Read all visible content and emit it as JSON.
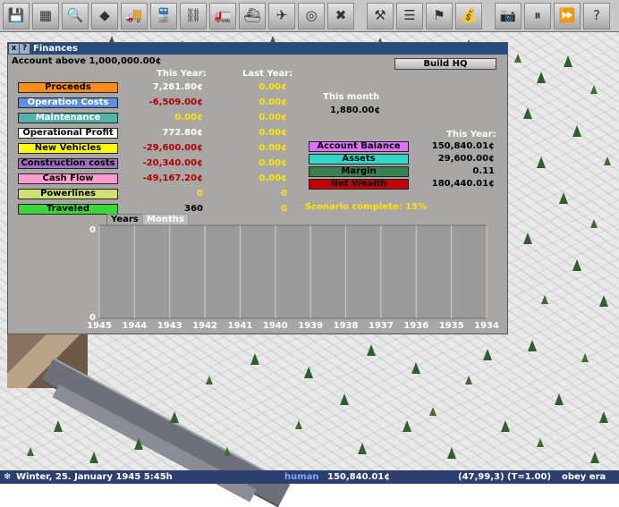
{
  "toolbar": {
    "buttons": [
      {
        "icon": "disk-icon",
        "glyph": "💾",
        "gap": false
      },
      {
        "icon": "minimap-icon",
        "glyph": "▦",
        "gap": false
      },
      {
        "icon": "magnifier-icon",
        "glyph": "🔍",
        "gap": false
      },
      {
        "icon": "terrain-icon",
        "glyph": "◆",
        "gap": false
      },
      {
        "icon": "road-vehicle-icon",
        "glyph": "🚚",
        "gap": false
      },
      {
        "icon": "train-icon",
        "glyph": "🚆",
        "gap": false
      },
      {
        "icon": "rail-tool-icon",
        "glyph": "⛓",
        "gap": false
      },
      {
        "icon": "truck-icon",
        "glyph": "🚛",
        "gap": false
      },
      {
        "icon": "ship-icon",
        "glyph": "⛴",
        "gap": false
      },
      {
        "icon": "airplane-icon",
        "glyph": "✈",
        "gap": false
      },
      {
        "icon": "target-icon",
        "glyph": "◎",
        "gap": false
      },
      {
        "icon": "remove-icon",
        "glyph": "✖",
        "gap": false
      },
      {
        "icon": "build-icon",
        "glyph": "⚒",
        "gap": true
      },
      {
        "icon": "list-icon",
        "glyph": "☰",
        "gap": false
      },
      {
        "icon": "sign-icon",
        "glyph": "⚑",
        "gap": false
      },
      {
        "icon": "money-icon",
        "glyph": "💰",
        "gap": false
      },
      {
        "icon": "camera-icon",
        "glyph": "📷",
        "gap": true
      },
      {
        "icon": "pause-icon",
        "glyph": "⏸",
        "gap": false
      },
      {
        "icon": "fast-forward-icon",
        "glyph": "⏩",
        "gap": false
      },
      {
        "icon": "help-icon",
        "glyph": "?",
        "gap": false
      }
    ]
  },
  "window": {
    "close_glyph": "x",
    "help_glyph": "?",
    "title": "Finances",
    "account_note": "Account above 1,000,000.00¢",
    "build_hq_label": "Build HQ",
    "this_year_header": "This Year:",
    "last_year_header": "Last Year:",
    "this_month_header": "This month",
    "this_month_value": "1,880.00¢",
    "this_year_header_2": "This Year:",
    "scenario_text": "Scenario complete: 15%",
    "rows": [
      {
        "label": "Proceeds",
        "bg": "#ff8c1a",
        "fg": "#000000",
        "this_year": "7,281.80¢",
        "ty_color": "#ffffff",
        "last_year": "0.00¢"
      },
      {
        "label": "Operation Costs",
        "bg": "#5b8fe0",
        "fg": "#ffffff",
        "this_year": "-6,509.00¢",
        "ty_color": "#b10000",
        "last_year": "0.00¢"
      },
      {
        "label": "Maintenance",
        "bg": "#53b3aa",
        "fg": "#ffffff",
        "this_year": "0.00¢",
        "ty_color": "#ffe300",
        "last_year": "0.00¢"
      },
      {
        "label": "Operational Profit",
        "bg": "#ffffff",
        "fg": "#000000",
        "this_year": "772.80¢",
        "ty_color": "#ffffff",
        "last_year": "0.00¢"
      },
      {
        "label": "New Vehicles",
        "bg": "#ffff00",
        "fg": "#000000",
        "this_year": "-29,600.00¢",
        "ty_color": "#b10000",
        "last_year": "0.00¢"
      },
      {
        "label": "Construction costs",
        "bg": "#a070c0",
        "fg": "#000000",
        "this_year": "-20,340.00¢",
        "ty_color": "#b10000",
        "last_year": "0.00¢"
      },
      {
        "label": "Cash Flow",
        "bg": "#ff9cd0",
        "fg": "#000000",
        "this_year": "-49,167.20¢",
        "ty_color": "#b10000",
        "last_year": "0.00¢"
      },
      {
        "label": "Powerlines",
        "bg": "#cfe070",
        "fg": "#000000",
        "this_year": "0",
        "ty_color": "#ffe300",
        "last_year": "0"
      },
      {
        "label": "Traveled",
        "bg": "#38d838",
        "fg": "#000000",
        "this_year": "360",
        "ty_color": "#000000",
        "last_year": "0"
      }
    ],
    "summary": [
      {
        "label": "Account Balance",
        "bg": "#e070ff",
        "fg": "#000000",
        "value": "150,840.01¢"
      },
      {
        "label": "Assets",
        "bg": "#30d8c8",
        "fg": "#000000",
        "value": "29,600.00¢"
      },
      {
        "label": "Margin",
        "bg": "#3a8050",
        "fg": "#000000",
        "value": "0.11"
      },
      {
        "label": "Net Wealth",
        "bg": "#c00000",
        "fg": "#000000",
        "value": "180,440.01¢"
      }
    ],
    "chart_tabs": {
      "years": "Years",
      "months": "Months"
    }
  },
  "chart_data": {
    "type": "line",
    "title": "",
    "xlabel": "",
    "ylabel": "",
    "categories": [
      "1945",
      "1944",
      "1943",
      "1942",
      "1941",
      "1940",
      "1939",
      "1938",
      "1937",
      "1936",
      "1935",
      "1934"
    ],
    "y_ticks": [
      "0",
      "0"
    ],
    "series": [],
    "grid": true
  },
  "status": {
    "date": "Winter, 25. January 1945 5:45h",
    "player": "human",
    "balance": "150,840.01¢",
    "coords": "(47,99,3) (T=1.00)",
    "era": "obey era"
  }
}
